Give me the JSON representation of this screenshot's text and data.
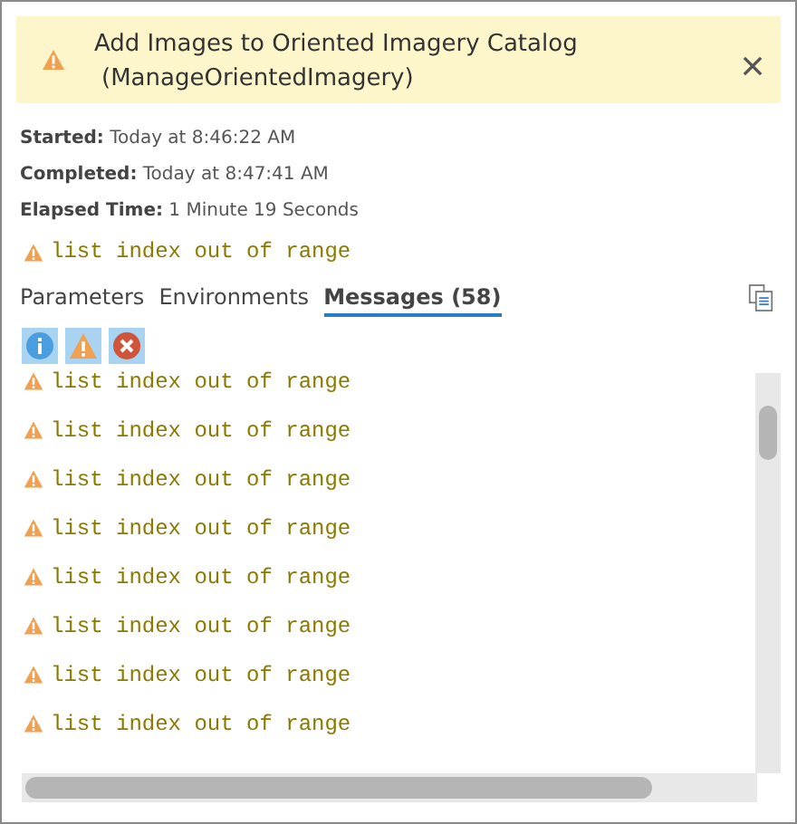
{
  "banner": {
    "kind": "warning",
    "title": "Add Images to Oriented Imagery Catalog",
    "subtitle": "(ManageOrientedImagery)"
  },
  "details": [
    {
      "label": "Started:",
      "value": "Today at 8:46:22 AM"
    },
    {
      "label": "Completed:",
      "value": "Today at 8:47:41 AM"
    },
    {
      "label": "Elapsed Time:",
      "value": "1 Minute 19 Seconds"
    }
  ],
  "summary": {
    "kind": "warning",
    "text": "list index out of range"
  },
  "tabs": [
    {
      "label": "Parameters",
      "selected": false
    },
    {
      "label": "Environments",
      "selected": false
    },
    {
      "label": "Messages (58)",
      "selected": true
    }
  ],
  "filters": [
    {
      "kind": "info",
      "selected": true
    },
    {
      "kind": "warning",
      "selected": true
    },
    {
      "kind": "error",
      "selected": true
    }
  ],
  "messages": [
    {
      "kind": "warning",
      "text": "list index out of range"
    },
    {
      "kind": "warning",
      "text": "list index out of range"
    },
    {
      "kind": "warning",
      "text": "list index out of range"
    },
    {
      "kind": "warning",
      "text": "list index out of range"
    },
    {
      "kind": "warning",
      "text": "list index out of range"
    },
    {
      "kind": "warning",
      "text": "list index out of range"
    },
    {
      "kind": "warning",
      "text": "list index out of range"
    },
    {
      "kind": "warning",
      "text": "list index out of range"
    }
  ]
}
